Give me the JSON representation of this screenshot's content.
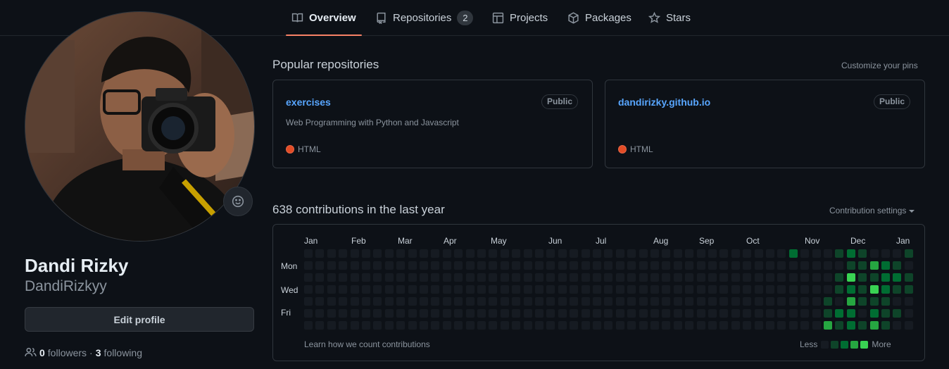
{
  "nav": {
    "tabs": [
      {
        "label": "Overview",
        "icon": "book-icon",
        "active": true
      },
      {
        "label": "Repositories",
        "icon": "repo-icon",
        "count": "2"
      },
      {
        "label": "Projects",
        "icon": "table-icon"
      },
      {
        "label": "Packages",
        "icon": "package-icon"
      },
      {
        "label": "Stars",
        "icon": "star-icon"
      }
    ]
  },
  "profile": {
    "full_name": "Dandi Rizky",
    "username": "DandiRizkyy",
    "edit_label": "Edit profile",
    "followers_count": "0",
    "followers_label": "followers",
    "separator": "·",
    "following_count": "3",
    "following_label": "following",
    "avatar_icon": "avatar-photo",
    "status_icon": "smiley-icon"
  },
  "pinned": {
    "title": "Popular repositories",
    "customize_label": "Customize your pins",
    "repos": [
      {
        "name": "exercises",
        "visibility": "Public",
        "description": "Web Programming with Python and Javascript",
        "language": "HTML",
        "language_color": "#e34c26"
      },
      {
        "name": "dandirizky.github.io",
        "visibility": "Public",
        "description": "",
        "language": "HTML",
        "language_color": "#e34c26"
      }
    ]
  },
  "contributions": {
    "title": "638 contributions in the last year",
    "settings_label": "Contribution settings",
    "months": [
      "Jan",
      "Feb",
      "Mar",
      "Apr",
      "May",
      "Jun",
      "Jul",
      "Aug",
      "Sep",
      "Oct",
      "Nov",
      "Dec",
      "Jan"
    ],
    "day_labels": [
      "Mon",
      "Wed",
      "Fri"
    ],
    "learn_label": "Learn how we count contributions",
    "legend_less": "Less",
    "legend_more": "More",
    "level_colors": [
      "#161b22",
      "#0e4429",
      "#006d32",
      "#26a641",
      "#39d353"
    ],
    "weeks": 53,
    "active_cells": [
      {
        "week": 42,
        "day": 0,
        "level": 2
      },
      {
        "week": 46,
        "day": 0,
        "level": 1
      },
      {
        "week": 47,
        "day": 0,
        "level": 2
      },
      {
        "week": 48,
        "day": 0,
        "level": 1
      },
      {
        "week": 52,
        "day": 0,
        "level": 1
      },
      {
        "week": 47,
        "day": 1,
        "level": 1
      },
      {
        "week": 48,
        "day": 1,
        "level": 1
      },
      {
        "week": 49,
        "day": 1,
        "level": 3
      },
      {
        "week": 50,
        "day": 1,
        "level": 2
      },
      {
        "week": 51,
        "day": 1,
        "level": 1
      },
      {
        "week": 46,
        "day": 2,
        "level": 1
      },
      {
        "week": 47,
        "day": 2,
        "level": 4
      },
      {
        "week": 48,
        "day": 2,
        "level": 1
      },
      {
        "week": 49,
        "day": 2,
        "level": 1
      },
      {
        "week": 50,
        "day": 2,
        "level": 2
      },
      {
        "week": 51,
        "day": 2,
        "level": 2
      },
      {
        "week": 52,
        "day": 2,
        "level": 1
      },
      {
        "week": 46,
        "day": 3,
        "level": 1
      },
      {
        "week": 47,
        "day": 3,
        "level": 2
      },
      {
        "week": 48,
        "day": 3,
        "level": 1
      },
      {
        "week": 49,
        "day": 3,
        "level": 4
      },
      {
        "week": 50,
        "day": 3,
        "level": 2
      },
      {
        "week": 51,
        "day": 3,
        "level": 1
      },
      {
        "week": 52,
        "day": 3,
        "level": 1
      },
      {
        "week": 45,
        "day": 4,
        "level": 1
      },
      {
        "week": 47,
        "day": 4,
        "level": 3
      },
      {
        "week": 48,
        "day": 4,
        "level": 1
      },
      {
        "week": 49,
        "day": 4,
        "level": 1
      },
      {
        "week": 50,
        "day": 4,
        "level": 1
      },
      {
        "week": 45,
        "day": 5,
        "level": 1
      },
      {
        "week": 46,
        "day": 5,
        "level": 2
      },
      {
        "week": 47,
        "day": 5,
        "level": 2
      },
      {
        "week": 49,
        "day": 5,
        "level": 2
      },
      {
        "week": 50,
        "day": 5,
        "level": 1
      },
      {
        "week": 51,
        "day": 5,
        "level": 1
      },
      {
        "week": 45,
        "day": 6,
        "level": 3
      },
      {
        "week": 46,
        "day": 6,
        "level": 1
      },
      {
        "week": 47,
        "day": 6,
        "level": 2
      },
      {
        "week": 48,
        "day": 6,
        "level": 1
      },
      {
        "week": 49,
        "day": 6,
        "level": 3
      },
      {
        "week": 50,
        "day": 6,
        "level": 1
      }
    ]
  }
}
